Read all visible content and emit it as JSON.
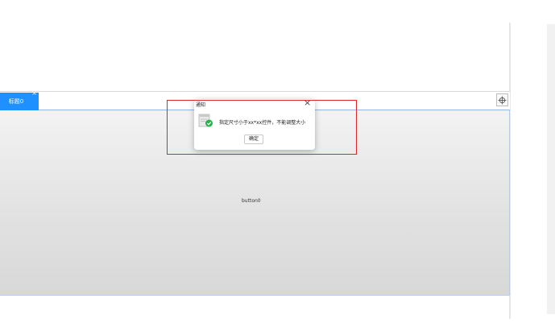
{
  "tabs": [
    {
      "label": "标题0",
      "close_glyph": "×",
      "active": true
    }
  ],
  "add_tab_icon": "plus-circle-icon",
  "main": {
    "label": "button0"
  },
  "dialog": {
    "title": "通知",
    "close_glyph": "×",
    "icon": "success-document-icon",
    "message": "指定尺寸小于xx*xx控件，不能调整大小",
    "ok_label": "确定"
  },
  "colors": {
    "tab_active": "#1e90ff",
    "highlight": "#e0262a",
    "success": "#28b34a"
  }
}
